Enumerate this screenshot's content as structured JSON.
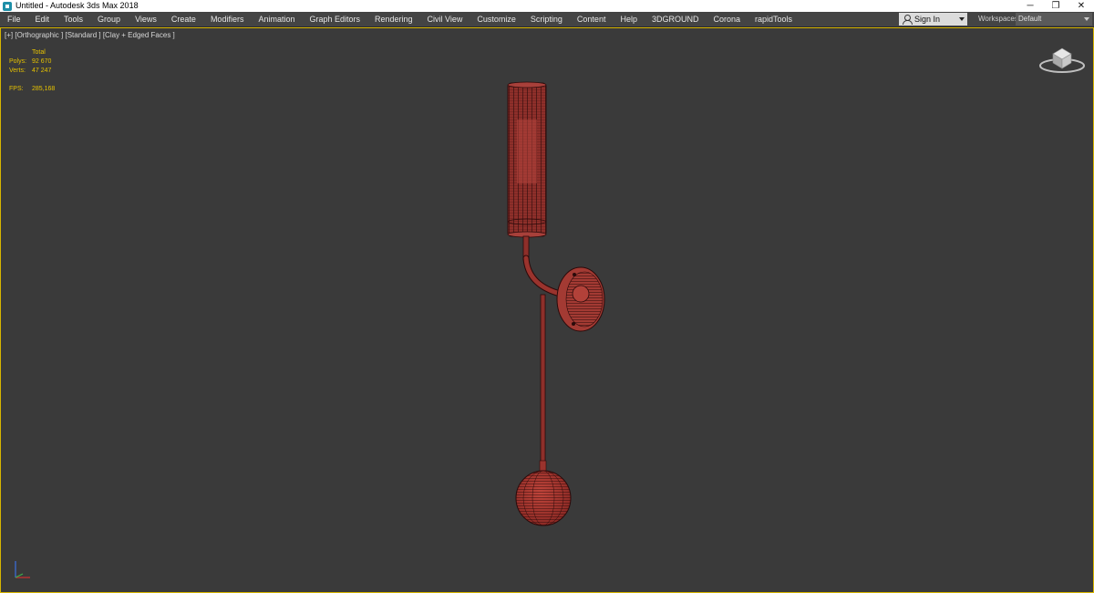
{
  "window": {
    "title": "Untitled - Autodesk 3ds Max 2018",
    "controls": {
      "minimize": "─",
      "restore": "❐",
      "close": "✕"
    }
  },
  "menu": {
    "items": [
      "File",
      "Edit",
      "Tools",
      "Group",
      "Views",
      "Create",
      "Modifiers",
      "Animation",
      "Graph Editors",
      "Rendering",
      "Civil View",
      "Customize",
      "Scripting",
      "Content",
      "Help",
      "3DGROUND",
      "Corona",
      "rapidTools"
    ]
  },
  "account": {
    "signin_label": "Sign In"
  },
  "workspaces": {
    "label": "Workspaces:",
    "value": "Default"
  },
  "viewport": {
    "label": "[+] [Orthographic ] [Standard ] [Clay + Edged Faces ]",
    "stats": {
      "total_label": "Total",
      "polys_label": "Polys:",
      "polys_value": "92 670",
      "verts_label": "Verts:",
      "verts_value": "47 247",
      "fps_label": "FPS:",
      "fps_value": "285,168"
    }
  },
  "colors": {
    "viewport_bg": "#3a3a3a",
    "active_border": "#d7b500",
    "stats_text": "#e6c200",
    "model_fill": "#a33a33",
    "model_wire": "#2a0a0a"
  },
  "icons": [
    "app-icon",
    "user-icon",
    "viewcube-icon",
    "axis-tripod-icon"
  ]
}
